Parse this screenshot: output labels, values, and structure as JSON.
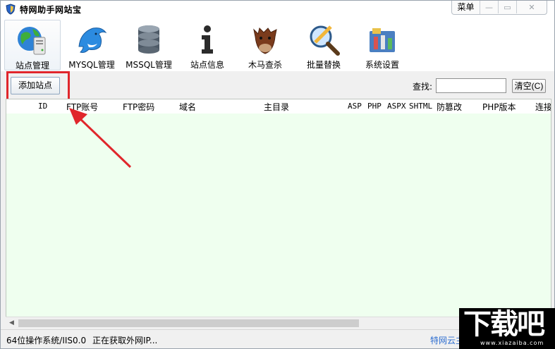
{
  "window": {
    "title": "特网助手网站宝",
    "menu_label": "菜单"
  },
  "toolbar": {
    "items": [
      {
        "label": "站点管理",
        "icon": "globe-server-icon",
        "active": true
      },
      {
        "label": "MYSQL管理",
        "icon": "dolphin-icon",
        "active": false
      },
      {
        "label": "MSSQL管理",
        "icon": "database-icon",
        "active": false
      },
      {
        "label": "站点信息",
        "icon": "info-icon",
        "active": false
      },
      {
        "label": "木马查杀",
        "icon": "horse-icon",
        "active": false
      },
      {
        "label": "批量替换",
        "icon": "magnifier-icon",
        "active": false
      },
      {
        "label": "系统设置",
        "icon": "settings-tools-icon",
        "active": false
      }
    ]
  },
  "actions": {
    "add_site_label": "添加站点",
    "search_label": "查找:",
    "search_value": "",
    "clear_label": "清空(C)"
  },
  "table": {
    "columns": [
      "ID",
      "FTP账号",
      "FTP密码",
      "域名",
      "主目录",
      "ASP",
      "PHP",
      "ASPX",
      "SHTML",
      "防篡改",
      "PHP版本",
      "连接"
    ],
    "rows": []
  },
  "status": {
    "os": "64位操作系统/IIS0.0",
    "message": "正在获取外网IP...",
    "link": "特网云主"
  },
  "watermark": {
    "big": "下载吧",
    "small": "www.xiazaiba.com"
  },
  "colors": {
    "highlight": "#e0262b",
    "table_bg": "#efffef",
    "link": "#2f6fd1"
  }
}
